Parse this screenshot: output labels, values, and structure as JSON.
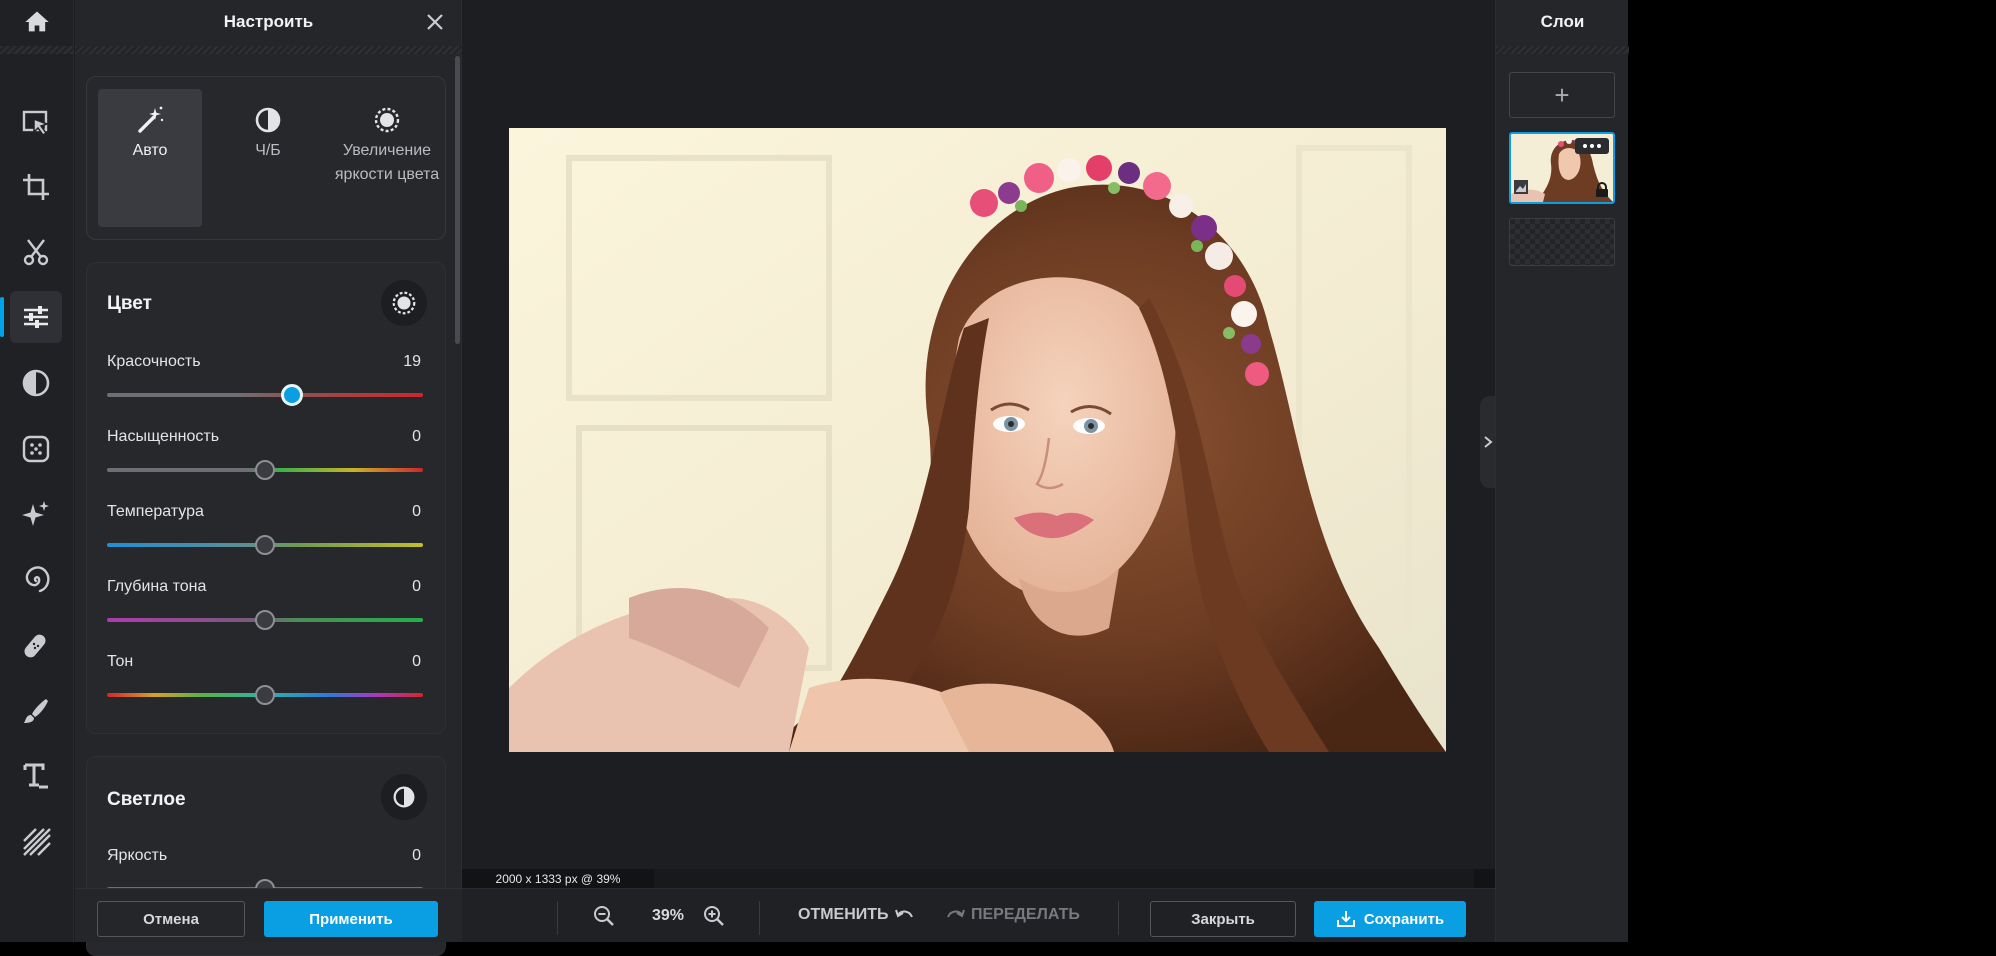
{
  "adjust_panel": {
    "title": "Настроить",
    "presets": [
      {
        "label": "Авто",
        "icon": "magic-wand-icon",
        "active": true
      },
      {
        "label": "Ч/Б",
        "icon": "contrast-icon",
        "active": false
      },
      {
        "label": "Увеличение яркости цвета",
        "icon": "vibrance-icon",
        "active": false
      }
    ],
    "color_section": {
      "title": "Цвет",
      "sliders": [
        {
          "label": "Красочность",
          "value": "19",
          "fraction": 0.585
        },
        {
          "label": "Насыщенность",
          "value": "0",
          "fraction": 0.5
        },
        {
          "label": "Температура",
          "value": "0",
          "fraction": 0.5
        },
        {
          "label": "Глубина тона",
          "value": "0",
          "fraction": 0.5
        },
        {
          "label": "Тон",
          "value": "0",
          "fraction": 0.5
        }
      ]
    },
    "light_section": {
      "title": "Светлое",
      "sliders": [
        {
          "label": "Яркость",
          "value": "0",
          "fraction": 0.5
        }
      ]
    },
    "cancel_label": "Отмена",
    "apply_label": "Применить"
  },
  "canvas": {
    "image_info": "2000 x 1333 px @ 39%"
  },
  "bottom_bar": {
    "zoom": "39%",
    "undo_label": "ОТМЕНИТЬ",
    "redo_label": "ПЕРЕДЕЛАТЬ",
    "close_label": "Закрыть",
    "save_label": "Сохранить"
  },
  "layers_panel": {
    "title": "Слои",
    "add_label": "+"
  },
  "colors": {
    "accent": "#0a9fe3",
    "background": "#1c1d20",
    "panel": "#25262a"
  }
}
